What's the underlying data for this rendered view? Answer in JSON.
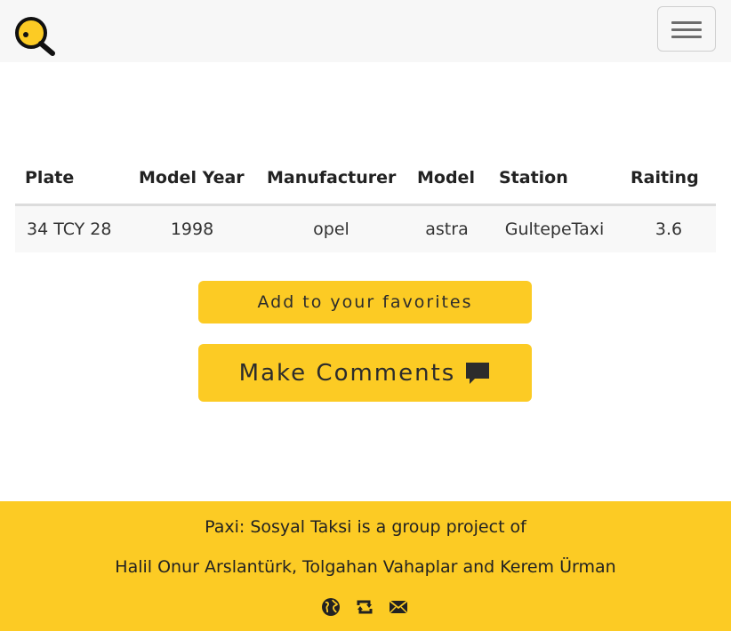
{
  "navbar": {
    "logo_icon": "magnifier-logo-icon",
    "toggle_icon": "hamburger-menu-icon"
  },
  "table": {
    "headers": [
      "Plate",
      "Model Year",
      "Manufacturer",
      "Model",
      "Station",
      "Raiting"
    ],
    "rows": [
      [
        "34 TCY 28",
        "1998",
        "opel",
        "astra",
        "GultepeTaxi",
        "3.6"
      ]
    ]
  },
  "actions": {
    "favorite_label": "Add to your favorites",
    "comment_label": "Make Comments",
    "comment_icon": "comment-icon"
  },
  "footer": {
    "line1": "Paxi: Sosyal Taksi is a group project of",
    "line2": "Halil Onur Arslantürk, Tolgahan Vahaplar and Kerem Ürman",
    "icons": [
      "globe-icon",
      "retweet-icon",
      "envelope-icon"
    ]
  },
  "colors": {
    "accent": "#fccb24",
    "navbar_bg": "#f7f7f7",
    "row_bg": "#f8f8f8"
  }
}
